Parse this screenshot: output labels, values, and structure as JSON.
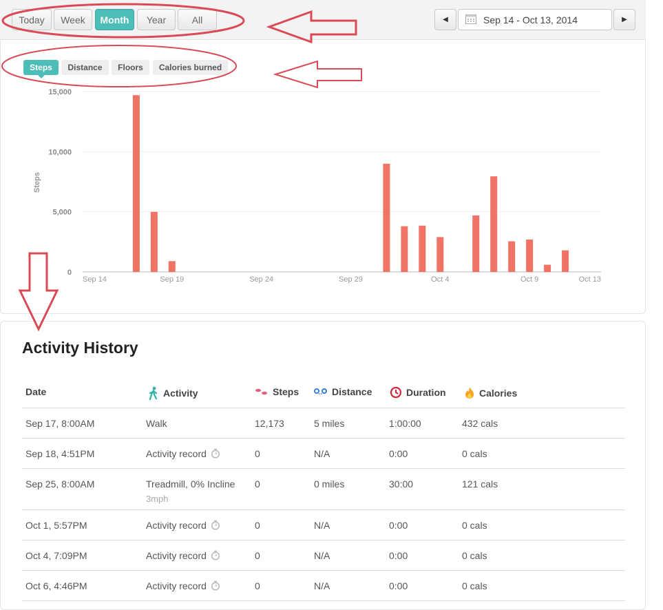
{
  "range_tabs": [
    {
      "label": "Today",
      "active": false
    },
    {
      "label": "Week",
      "active": false
    },
    {
      "label": "Month",
      "active": true
    },
    {
      "label": "Year",
      "active": false
    },
    {
      "label": "All",
      "active": false
    }
  ],
  "date_range": "Sep 14 - Oct 13, 2014",
  "metric_tabs": [
    {
      "label": "Steps",
      "active": true
    },
    {
      "label": "Distance",
      "active": false
    },
    {
      "label": "Floors",
      "active": false
    },
    {
      "label": "Calories burned",
      "active": false
    }
  ],
  "chart_data": {
    "type": "bar",
    "ylabel": "Steps",
    "ylim": [
      0,
      15000
    ],
    "yticks": [
      "0",
      "5,000",
      "10,000",
      "15,000"
    ],
    "ytick_values": [
      0,
      5000,
      10000,
      15000
    ],
    "xticks": [
      "Sep 14",
      "Sep 19",
      "Sep 24",
      "Sep 29",
      "Oct 4",
      "Oct 9",
      "Oct 13"
    ],
    "xtick_days": [
      0,
      5,
      10,
      15,
      20,
      25,
      29
    ],
    "categories": [
      "Sep 14",
      "Sep 15",
      "Sep 16",
      "Sep 17",
      "Sep 18",
      "Sep 19",
      "Sep 20",
      "Sep 21",
      "Sep 22",
      "Sep 23",
      "Sep 24",
      "Sep 25",
      "Sep 26",
      "Sep 27",
      "Sep 28",
      "Sep 29",
      "Sep 30",
      "Oct 1",
      "Oct 2",
      "Oct 3",
      "Oct 4",
      "Oct 5",
      "Oct 6",
      "Oct 7",
      "Oct 8",
      "Oct 9",
      "Oct 10",
      "Oct 11",
      "Oct 12",
      "Oct 13"
    ],
    "values": [
      0,
      0,
      0,
      14700,
      5000,
      900,
      0,
      0,
      0,
      0,
      0,
      0,
      0,
      0,
      0,
      0,
      0,
      9000,
      3800,
      3850,
      2900,
      0,
      4700,
      7950,
      2550,
      2700,
      600,
      1800,
      0,
      0
    ],
    "bar_color": "#f07466",
    "grid": true
  },
  "history": {
    "title": "Activity History",
    "columns": [
      {
        "label": "Date",
        "icon": ""
      },
      {
        "label": "Activity",
        "icon": "walking-person-icon"
      },
      {
        "label": "Steps",
        "icon": "footprints-icon"
      },
      {
        "label": "Distance",
        "icon": "distance-pin-icon"
      },
      {
        "label": "Duration",
        "icon": "clock-icon"
      },
      {
        "label": "Calories",
        "icon": "flame-icon"
      }
    ],
    "rows": [
      {
        "date": "Sep 17, 8:00AM",
        "activity": "Walk",
        "sub": "",
        "timer": false,
        "steps": "12,173",
        "distance": "5 miles",
        "duration": "1:00:00",
        "calories": "432 cals"
      },
      {
        "date": "Sep 18, 4:51PM",
        "activity": "Activity record",
        "sub": "",
        "timer": true,
        "steps": "0",
        "distance": "N/A",
        "duration": "0:00",
        "calories": "0 cals"
      },
      {
        "date": "Sep 25, 8:00AM",
        "activity": "Treadmill, 0% Incline",
        "sub": "3mph",
        "timer": false,
        "steps": "0",
        "distance": "0 miles",
        "duration": "30:00",
        "calories": "121 cals"
      },
      {
        "date": "Oct 1, 5:57PM",
        "activity": "Activity record",
        "sub": "",
        "timer": true,
        "steps": "0",
        "distance": "N/A",
        "duration": "0:00",
        "calories": "0 cals"
      },
      {
        "date": "Oct 4, 7:09PM",
        "activity": "Activity record",
        "sub": "",
        "timer": true,
        "steps": "0",
        "distance": "N/A",
        "duration": "0:00",
        "calories": "0 cals"
      },
      {
        "date": "Oct 6, 4:46PM",
        "activity": "Activity record",
        "sub": "",
        "timer": true,
        "steps": "0",
        "distance": "N/A",
        "duration": "0:00",
        "calories": "0 cals"
      }
    ]
  },
  "colors": {
    "accent": "#4dbdb8",
    "bar": "#f07466",
    "annotation": "#d94a55"
  }
}
